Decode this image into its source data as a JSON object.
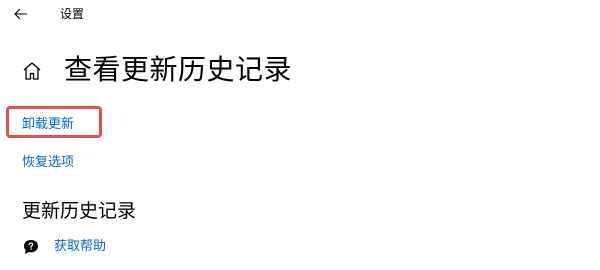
{
  "window": {
    "title": "设置"
  },
  "header": {
    "title": "查看更新历史记录"
  },
  "links": {
    "uninstall_updates": "卸载更新",
    "recovery_options": "恢复选项"
  },
  "section": {
    "title": "更新历史记录"
  },
  "help": {
    "label": "获取帮助"
  },
  "colors": {
    "link": "#0067c0",
    "highlight": "#e0504f",
    "background": "#ffffff"
  },
  "icons": {
    "back": "back-arrow-icon",
    "home": "home-icon",
    "help": "help-chat-icon"
  }
}
